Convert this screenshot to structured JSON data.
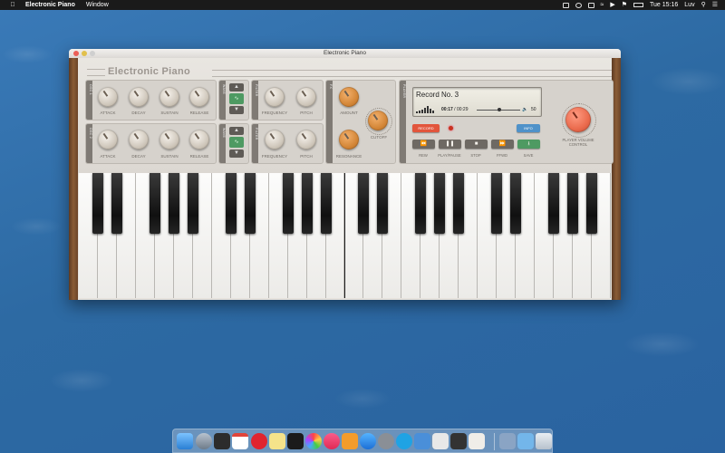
{
  "menubar": {
    "apple_icon": "apple-icon",
    "app_name": "Electronic Piano",
    "menus": [
      "Window"
    ],
    "clock": "Tue 15:16",
    "user": "Luv"
  },
  "window": {
    "title": "Electronic Piano",
    "brand": "Electronic Piano"
  },
  "osc1": {
    "tab": "OSC 1",
    "knobs": [
      "ATTACK",
      "DECAY",
      "SUSTAIN",
      "RELEASE"
    ]
  },
  "osc2": {
    "tab": "OSC 2",
    "knobs": [
      "ATTACK",
      "DECAY",
      "SUSTAIN",
      "RELEASE"
    ]
  },
  "wave1": {
    "tab": "WAVE"
  },
  "wave2": {
    "tab": "WAVE"
  },
  "filter1": {
    "tab": "FILTER",
    "knobs": [
      "FREQUENCY",
      "PITCH"
    ]
  },
  "filter2": {
    "tab": "FILTER",
    "knobs": [
      "FREQUENCY",
      "PITCH"
    ]
  },
  "fx": {
    "tab": "FX",
    "amount": "AMOUNT",
    "resonance": "RESONANCE",
    "cutoff": "CUTOFF"
  },
  "player": {
    "tab": "PLAYER",
    "record_name": "Record No. 3",
    "elapsed": "00:17",
    "separator": " / ",
    "total": "00:29",
    "volume": "50",
    "record_btn": "RECORD",
    "info_btn": "INFO",
    "transport": [
      "REW",
      "PLAY/PAUSE",
      "STOP",
      "FFWD",
      "SAVE"
    ],
    "volume_label": "PLAYER VOLUME CONTROL",
    "colors": {
      "record": "#e2553c",
      "info": "#4f92c9",
      "save": "#4e9a62"
    }
  }
}
